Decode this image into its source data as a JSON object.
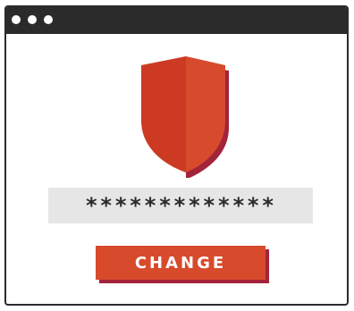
{
  "window": {
    "controls": [
      "window-dot",
      "window-dot",
      "window-dot"
    ]
  },
  "shield": {
    "icon": "shield-icon",
    "colors": {
      "left": "#cc3a23",
      "right": "#d84a2c",
      "shadow": "#a2233a"
    }
  },
  "password": {
    "value": "*************"
  },
  "actions": {
    "change_label": "CHANGE"
  },
  "colors": {
    "frame": "#2b2b2b",
    "field_background": "#e6e6e6",
    "accent": "#d84a2c",
    "accent_shadow": "#a2233a"
  }
}
